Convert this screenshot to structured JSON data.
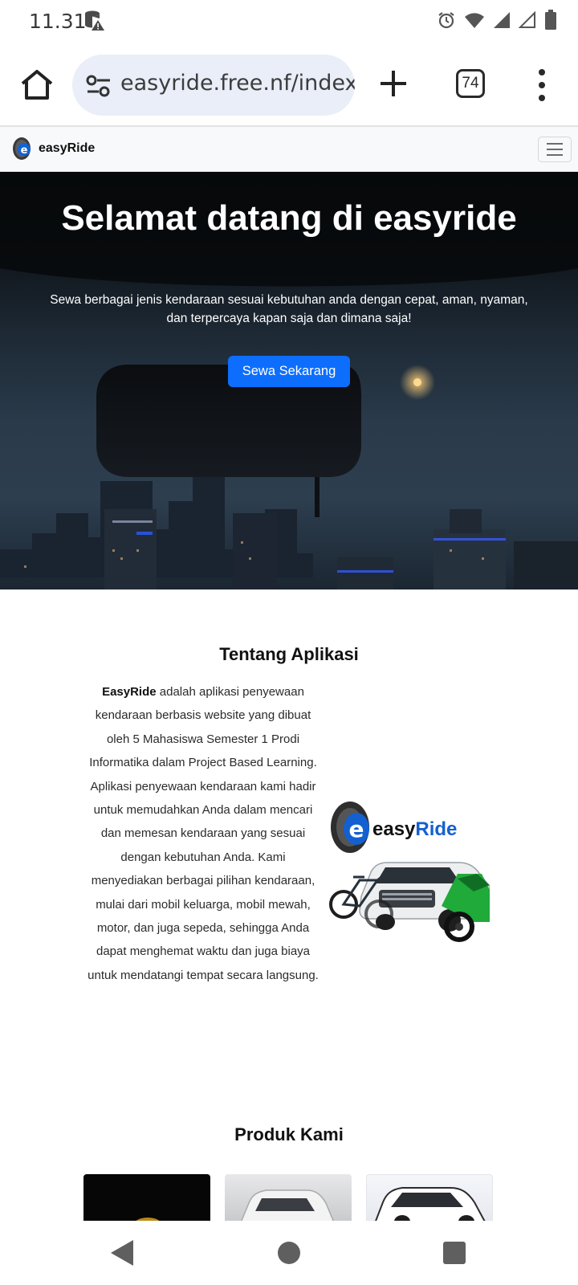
{
  "status_bar": {
    "time": "11.31",
    "icons": [
      "database-warning-icon",
      "alarm-icon",
      "wifi-icon",
      "signal-icon",
      "signal-outline-icon",
      "battery-icon"
    ]
  },
  "browser": {
    "url": "easyride.free.nf/index.p",
    "tab_count": "74",
    "icons": [
      "home-icon",
      "site-settings-icon",
      "plus-icon",
      "more-vert-icon"
    ]
  },
  "navbar": {
    "brand": "easyRide",
    "icons": [
      "brand-logo-icon",
      "hamburger-icon"
    ]
  },
  "hero": {
    "title": "Selamat datang di easyride",
    "subtitle": "Sewa berbagai jenis kendaraan sesuai kebutuhan anda dengan cepat, aman, nyaman, dan terpercaya kapan saja dan dimana saja!",
    "cta": "Sewa Sekarang",
    "cta_color": "#0d6efd"
  },
  "about": {
    "title": "Tentang Aplikasi",
    "brand": "EasyRide",
    "text": "adalah aplikasi penyewaan kendaraan berbasis website yang dibuat oleh 5 Mahasiswa Semester 1 Prodi Informatika dalam Project Based Learning. Aplikasi penyewaan kendaraan kami hadir untuk memudahkan Anda dalam mencari dan memesan kendaraan yang sesuai dengan kebutuhan Anda. Kami menyediakan berbagai pilihan kendaraan, mulai dari mobil keluarga, mobil mewah, motor, dan juga sepeda, sehingga Anda dapat menghemat waktu dan juga biaya untuk mendatangi tempat secara langsung.",
    "logo_text_prefix": "easy",
    "logo_text_suffix": "Ride"
  },
  "products": {
    "title": "Produk Kami"
  },
  "android_nav": {
    "icons": [
      "back-icon",
      "home-circle-icon",
      "recents-icon"
    ]
  }
}
